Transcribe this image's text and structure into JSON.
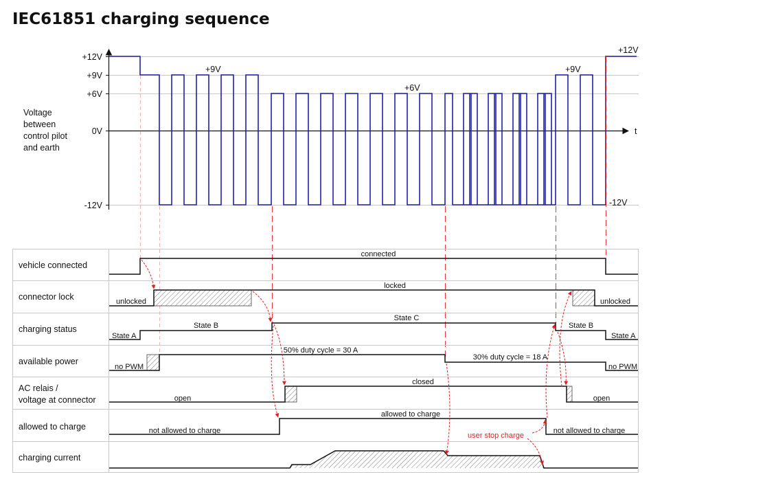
{
  "title": "IEC61851 charging sequence",
  "colors": {
    "waveform": "#1f1fa8",
    "annotation": "#e31e24",
    "grid": "#c8c8c8",
    "line": "#111111"
  },
  "chart": {
    "y_axis_label_lines": [
      "Voltage",
      "between",
      "control pilot",
      "and earth"
    ],
    "y_ticks": [
      "+12V",
      "+9V",
      "+6V",
      "0V",
      "-12V"
    ],
    "x_axis_label": "t",
    "level_labels": {
      "plus9_left": "+9V",
      "plus6": "+6V",
      "plus9_right": "+9V",
      "plus12_right": "+12V",
      "minus12_right": "-12V"
    }
  },
  "rows": [
    {
      "label_lines": [
        "vehicle connected"
      ],
      "texts": [
        "connected"
      ]
    },
    {
      "label_lines": [
        "connector lock"
      ],
      "texts": [
        "unlocked",
        "locked",
        "unlocked"
      ]
    },
    {
      "label_lines": [
        "charging status"
      ],
      "texts": [
        "State A",
        "State B",
        "State C",
        "State B",
        "State A"
      ]
    },
    {
      "label_lines": [
        "available power"
      ],
      "texts": [
        "no PWM",
        "50% duty cycle = 30 A",
        "30% duty cycle = 18 A",
        "no PWM"
      ]
    },
    {
      "label_lines": [
        "AC relais /",
        "voltage at connector"
      ],
      "texts": [
        "open",
        "closed",
        "open"
      ]
    },
    {
      "label_lines": [
        "allowed to charge"
      ],
      "texts": [
        "not allowed to charge",
        "allowed to charge",
        "not allowed to charge"
      ]
    },
    {
      "label_lines": [
        "charging current"
      ],
      "texts": []
    }
  ],
  "annotation": {
    "user_stop": "user stop charge"
  }
}
